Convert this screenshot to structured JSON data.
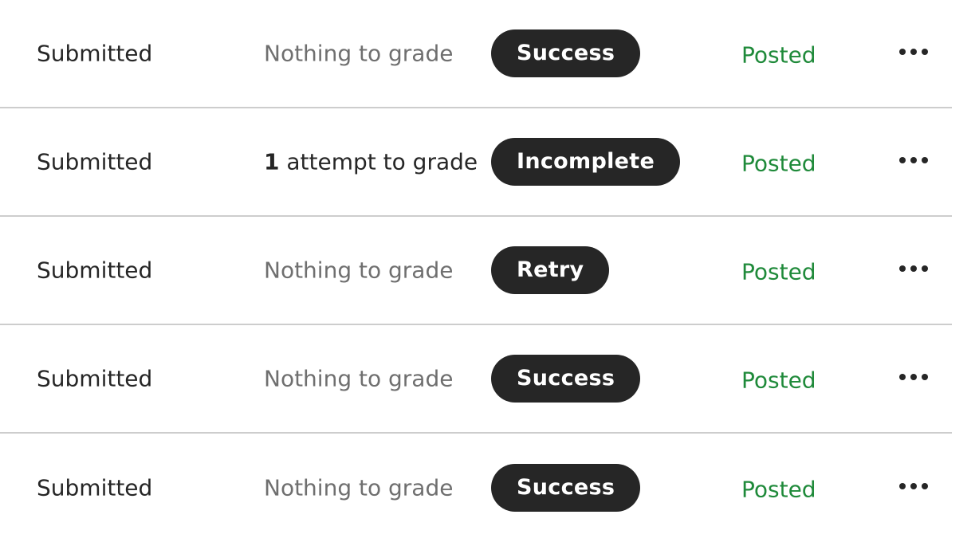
{
  "rows": [
    {
      "status": "Submitted",
      "grade_count": "",
      "grade_text": "Nothing to grade",
      "result": "Success",
      "posted": "Posted",
      "more_icon": "more-horizontal-icon"
    },
    {
      "status": "Submitted",
      "grade_count": "1",
      "grade_text": " attempt to grade",
      "result": "Incomplete",
      "posted": "Posted",
      "more_icon": "more-horizontal-icon"
    },
    {
      "status": "Submitted",
      "grade_count": "",
      "grade_text": "Nothing to grade",
      "result": "Retry",
      "posted": "Posted",
      "more_icon": "more-horizontal-icon"
    },
    {
      "status": "Submitted",
      "grade_count": "",
      "grade_text": "Nothing to grade",
      "result": "Success",
      "posted": "Posted",
      "more_icon": "more-horizontal-icon"
    },
    {
      "status": "Submitted",
      "grade_count": "",
      "grade_text": "Nothing to grade",
      "result": "Success",
      "posted": "Posted",
      "more_icon": "more-horizontal-icon"
    }
  ],
  "colors": {
    "pill_background": "#262626",
    "posted_text": "#1f8a3a",
    "muted_text": "#6f6f6f",
    "divider": "#cdcdcd"
  }
}
